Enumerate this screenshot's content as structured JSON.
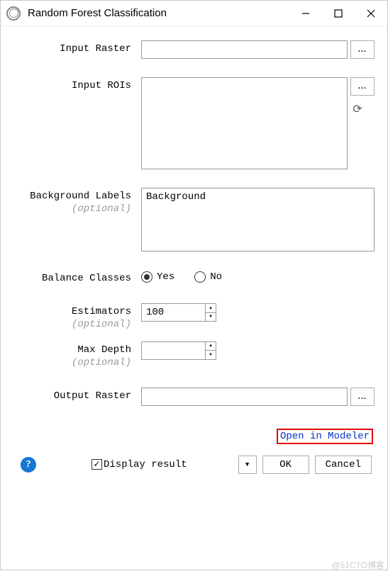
{
  "window": {
    "title": "Random Forest Classification"
  },
  "fields": {
    "input_raster": {
      "label": "Input Raster",
      "value": ""
    },
    "input_rois": {
      "label": "Input ROIs",
      "value": ""
    },
    "background_labels": {
      "label": "Background Labels",
      "optional": "(optional)",
      "value": "Background"
    },
    "balance_classes": {
      "label": "Balance Classes",
      "yes": "Yes",
      "no": "No",
      "selected": "Yes"
    },
    "estimators": {
      "label": "Estimators",
      "optional": "(optional)",
      "value": "100"
    },
    "max_depth": {
      "label": "Max Depth",
      "optional": "(optional)",
      "value": ""
    },
    "output_raster": {
      "label": "Output Raster",
      "value": ""
    }
  },
  "actions": {
    "browse": "...",
    "open_in_modeler": "Open in Modeler",
    "display_result": "Display result",
    "ok": "OK",
    "cancel": "Cancel"
  },
  "watermark": "@51CTO博客"
}
